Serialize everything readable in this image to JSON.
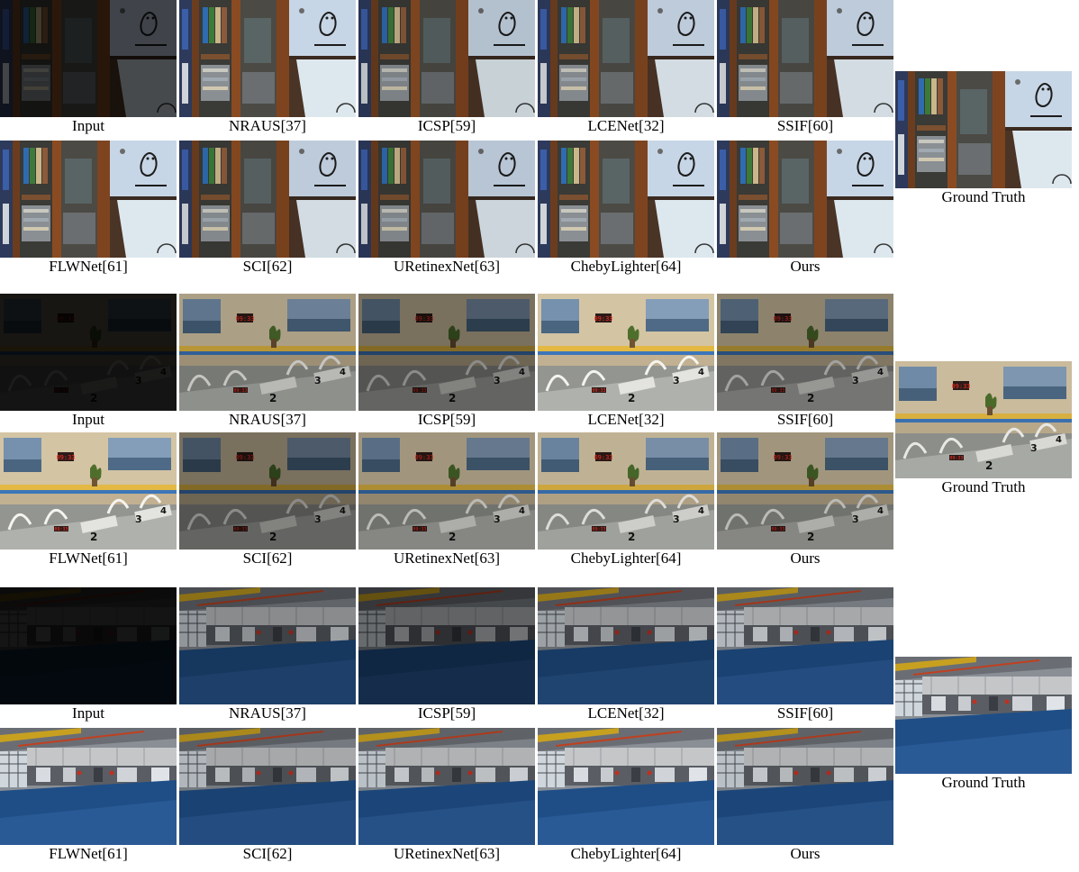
{
  "groups": [
    {
      "scene": "cabinet",
      "row1": [
        "Input",
        "NRAUS[37]",
        "ICSP[59]",
        "LCENet[32]",
        "SSIF[60]"
      ],
      "row2": [
        "FLWNet[61]",
        "SCI[62]",
        "URetinexNet[63]",
        "ChebyLighter[64]",
        "Ours"
      ],
      "ground_truth": "Ground Truth",
      "clock_text": ""
    },
    {
      "scene": "pool",
      "row1": [
        "Input",
        "NRAUS[37]",
        "ICSP[59]",
        "LCENet[32]",
        "SSIF[60]"
      ],
      "row2": [
        "FLWNet[61]",
        "SCI[62]",
        "URetinexNet[63]",
        "ChebyLighter[64]",
        "Ours"
      ],
      "ground_truth": "Ground Truth",
      "clock_text": "09:33"
    },
    {
      "scene": "hall",
      "row1": [
        "Input",
        "NRAUS[37]",
        "ICSP[59]",
        "LCENet[32]",
        "SSIF[60]"
      ],
      "row2": [
        "FLWNet[61]",
        "SCI[62]",
        "URetinexNet[63]",
        "ChebyLighter[64]",
        "Ours"
      ],
      "ground_truth": "Ground Truth",
      "clock_text": ""
    }
  ],
  "brightness": {
    "cabinet": {
      "row1": [
        0.32,
        1.0,
        0.9,
        0.95,
        0.95
      ],
      "row2": [
        1.0,
        0.95,
        0.92,
        1.0,
        1.0
      ],
      "gt": 1.0
    },
    "pool": {
      "row1": [
        0.12,
        0.85,
        0.6,
        1.05,
        0.7
      ],
      "row2": [
        1.05,
        0.6,
        0.8,
        0.95,
        0.8
      ],
      "gt": 1.0
    },
    "hall": {
      "row1": [
        0.1,
        0.7,
        0.5,
        0.75,
        0.85
      ],
      "row2": [
        1.0,
        0.85,
        0.9,
        1.0,
        0.9
      ],
      "gt": 1.0
    }
  }
}
